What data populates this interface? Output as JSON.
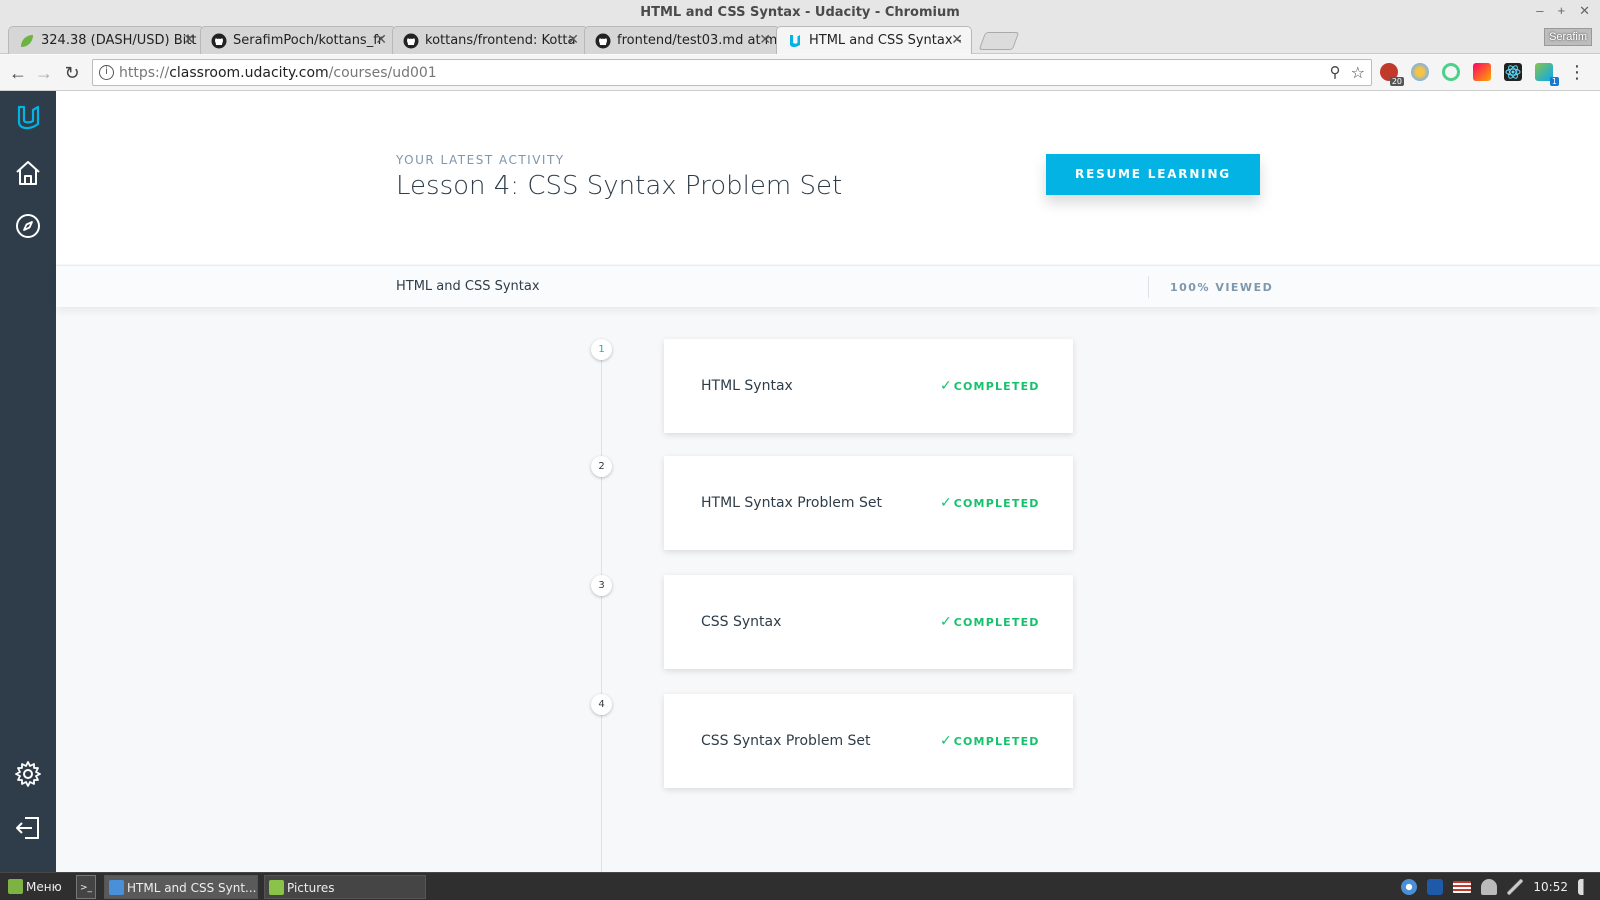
{
  "window": {
    "title": "HTML and CSS Syntax - Udacity - Chromium",
    "minimize": "–",
    "maximize": "+",
    "close": "✕"
  },
  "tabs": [
    {
      "label": "324.38 (DASH/USD) Bitt",
      "close": "✕"
    },
    {
      "label": "SerafimPoch/kottans_fr",
      "close": "✕"
    },
    {
      "label": "kottans/frontend: Kotta",
      "close": "✕"
    },
    {
      "label": "frontend/test03.md at m",
      "close": "✕"
    },
    {
      "label": "HTML and CSS Syntax -",
      "close": "✕"
    }
  ],
  "profile_name": "Serafim",
  "toolbar": {
    "back": "←",
    "forward": "→",
    "reload": "↻",
    "url_prefix": "https://",
    "url_host": "classroom.udacity.com",
    "url_path": "/courses/ud001",
    "info_glyph": "i",
    "zoom_glyph": "⚲",
    "star_glyph": "☆",
    "menu_glyph": "⋮",
    "ext_badges": {
      "abp": "20",
      "ext6": "1"
    }
  },
  "activity": {
    "label": "YOUR LATEST ACTIVITY",
    "title": "Lesson 4: CSS Syntax Problem Set",
    "resume_label": "RESUME LEARNING"
  },
  "course": {
    "name": "HTML and CSS Syntax",
    "viewed": "100% VIEWED"
  },
  "lessons": [
    {
      "number": "1",
      "title": "HTML Syntax",
      "status": "COMPLETED"
    },
    {
      "number": "2",
      "title": "HTML Syntax Problem Set",
      "status": "COMPLETED"
    },
    {
      "number": "3",
      "title": "CSS Syntax",
      "status": "COMPLETED"
    },
    {
      "number": "4",
      "title": "CSS Syntax Problem Set",
      "status": "COMPLETED"
    }
  ],
  "status_check": "✓",
  "taskbar": {
    "menu_label": "Меню",
    "terminal_glyph": ">_",
    "window_label": "HTML and CSS Synt...",
    "pictures_label": "Pictures",
    "clock": "10:52"
  },
  "colors": {
    "accent": "#02b3e4",
    "sidebar": "#2e3d49",
    "completed": "#15c26b"
  }
}
